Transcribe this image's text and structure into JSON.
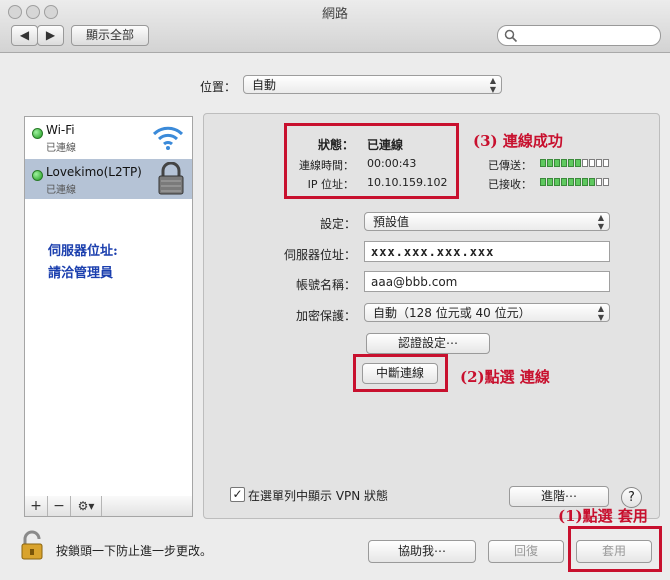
{
  "window": {
    "title": "網路"
  },
  "toolbar": {
    "show_all_label": "顯示全部",
    "search_placeholder": ""
  },
  "location": {
    "label": "位置：",
    "value": "自動"
  },
  "services": [
    {
      "name": "Wi-Fi",
      "status": "已連線"
    },
    {
      "name": "Lovekimo(L2TP)",
      "status": "已連線"
    }
  ],
  "sidebar_note": {
    "line1": "伺服器位址:",
    "line2": "請洽管理員"
  },
  "status": {
    "status_label": "狀態：",
    "status_value": "已連線",
    "time_label": "連線時間：",
    "time_value": "00:00:43",
    "ip_label": "IP 位址：",
    "ip_value": "10.10.159.102",
    "sent_label": "已傳送：",
    "received_label": "已接收：",
    "sent_level": 0.6,
    "received_level": 0.8
  },
  "form": {
    "config_label": "設定：",
    "config_value": "預設值",
    "server_label": "伺服器位址：",
    "server_value": "xxx.xxx.xxx.xxx",
    "account_label": "帳號名稱：",
    "account_value": "aaa@bbb.com",
    "encryption_label": "加密保護：",
    "encryption_value": "自動（128 位元或 40 位元）",
    "auth_button": "認證設定⋯",
    "disconnect_button": "中斷連線"
  },
  "annotations": {
    "step3": "(3) 連線成功",
    "step2": "(2)點選 連線",
    "step1": "(1)點選 套用"
  },
  "footer": {
    "show_vpn_label": "在選單列中顯示 VPN 狀態",
    "show_vpn_checked": true,
    "advanced_button": "進階⋯",
    "help_label": "?",
    "lock_text": "按鎖頭一下防止進一步更改。",
    "assist_button": "協助我⋯",
    "revert_button": "回復",
    "apply_button": "套用"
  },
  "sidebar_toolbar": {
    "add": "+",
    "remove": "−",
    "gear": "⚙▾"
  },
  "colors": {
    "accent_red": "#c8102e",
    "note_blue": "#1b3fae",
    "selection": "#b5c3d6"
  }
}
